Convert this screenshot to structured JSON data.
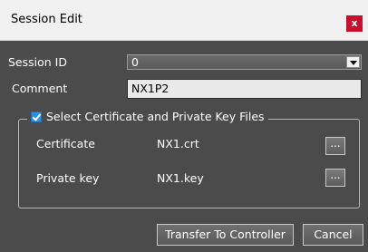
{
  "window": {
    "title": "Session Edit",
    "close_glyph": "x"
  },
  "session_id": {
    "label": "Session ID",
    "value": "0"
  },
  "comment": {
    "label": "Comment",
    "value": "NX1P2"
  },
  "cert_group": {
    "legend": "Select Certificate and Private Key Files",
    "checked": true,
    "certificate": {
      "label": "Certificate",
      "value": "NX1.crt",
      "browse_label": "..."
    },
    "private_key": {
      "label": "Private key",
      "value": "NX1.key",
      "browse_label": "..."
    }
  },
  "buttons": {
    "transfer": "Transfer To Controller",
    "cancel": "Cancel"
  },
  "colors": {
    "background": "#4b4b4b",
    "close": "#c8102e",
    "checkbox": "#2f8fe0"
  }
}
